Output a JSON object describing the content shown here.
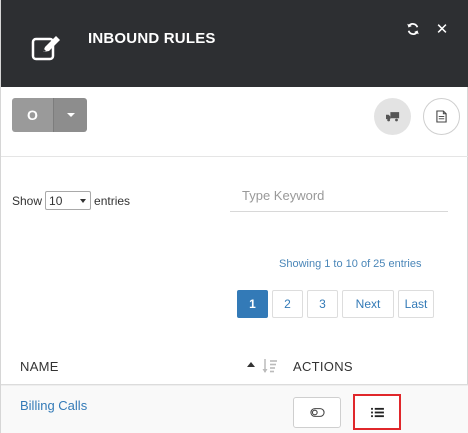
{
  "header": {
    "title": "INBOUND RULES"
  },
  "toolbar": {
    "split_button_label": "O"
  },
  "table_controls": {
    "show_label": "Show",
    "entries_value": "10",
    "entries_label": "entries",
    "search_placeholder": "Type Keyword",
    "showing_text": "Showing 1 to 10 of 25 entries"
  },
  "pagination": {
    "pages": [
      "1",
      "2",
      "3"
    ],
    "next": "Next",
    "last": "Last",
    "active_page": "1"
  },
  "table": {
    "columns": {
      "name": "NAME",
      "actions": "ACTIONS"
    },
    "rows": [
      {
        "name": "Billing Calls"
      }
    ]
  },
  "colors": {
    "header_bg": "#2d2f32",
    "link": "#337ab7",
    "highlight_border": "#e0272b"
  }
}
